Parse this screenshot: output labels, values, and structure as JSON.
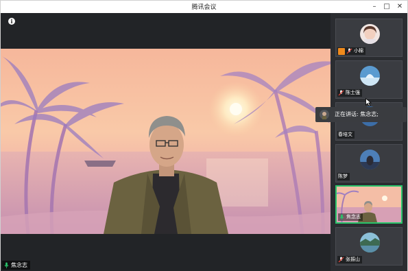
{
  "window": {
    "title": "腾讯会议",
    "controls": [
      "–",
      "□",
      "✕"
    ]
  },
  "main_video": {
    "speaker_name": "焦念志"
  },
  "tooltip": {
    "text": "正在讲话: 焦念志;"
  },
  "participants": [
    {
      "name": "小棉",
      "is_host": true,
      "muted": true
    },
    {
      "name": "陈士强",
      "is_host": false,
      "muted": true
    },
    {
      "name": "春培文",
      "is_host": false,
      "muted": false
    },
    {
      "name": "陈梦",
      "is_host": false,
      "muted": false
    },
    {
      "name": "焦念志",
      "is_host": false,
      "muted": false,
      "speaking": true
    },
    {
      "name": "张振山",
      "is_host": false,
      "muted": true
    }
  ],
  "colors": {
    "accent_green": "#29c66b",
    "host_orange": "#f08a1c",
    "muted_red": "#e0453a"
  }
}
